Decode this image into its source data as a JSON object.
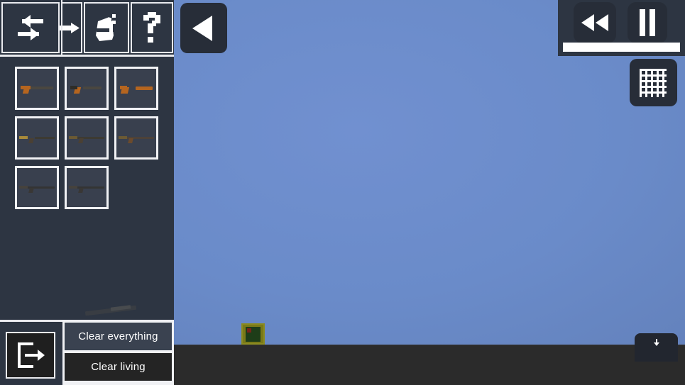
{
  "app": {
    "title": "Weapon Sandbox Editor",
    "background_sky_color": "#6a8bc9",
    "ground_color": "#2b2b2b",
    "panel_color": "#2d3542",
    "outline_color": "#e9eaee"
  },
  "toolbar": {
    "buttons": [
      {
        "name": "swap-tool",
        "icon": "swap-arrows-icon",
        "label": "Swap"
      },
      {
        "name": "move-tool",
        "icon": "arrow-right-icon",
        "label": "Move"
      },
      {
        "name": "paint-tool",
        "icon": "spray-can-icon",
        "label": "Paint"
      },
      {
        "name": "help-tool",
        "icon": "question-mark-icon",
        "label": "Help"
      }
    ]
  },
  "weapon_grid": {
    "rows": [
      [
        {
          "slot": 1,
          "name": "pistol",
          "label": "Pistol"
        },
        {
          "slot": 2,
          "name": "smg",
          "label": "SMG"
        },
        {
          "slot": 3,
          "name": "sawn-off",
          "label": "Sawn-off Shotgun"
        }
      ],
      [
        {
          "slot": 4,
          "name": "carbine",
          "label": "Carbine"
        },
        {
          "slot": 5,
          "name": "assault-rifle",
          "label": "Assault Rifle"
        },
        {
          "slot": 6,
          "name": "battle-rifle",
          "label": "Battle Rifle"
        }
      ],
      [
        {
          "slot": 7,
          "name": "sniper-rifle",
          "label": "Sniper Rifle"
        },
        {
          "slot": 8,
          "name": "machine-gun",
          "label": "Machine Gun"
        }
      ]
    ]
  },
  "preview": {
    "name": "selected-weapon-preview",
    "label": "Selected weapon preview"
  },
  "bottom_panel": {
    "exit_button": {
      "icon": "exit-icon",
      "label": "Exit"
    },
    "clear_everything_label": "Clear everything",
    "clear_living_label": "Clear living"
  },
  "overlay": {
    "back_button": {
      "icon": "play-left-icon",
      "label": "Back"
    },
    "rewind_button": {
      "icon": "rewind-icon",
      "label": "Rewind"
    },
    "pause_button": {
      "icon": "pause-icon",
      "label": "Pause"
    },
    "grid_button": {
      "icon": "grid-icon",
      "label": "Toggle grid"
    },
    "timebar": {
      "name": "time-slider",
      "value": 100
    },
    "bottom_right_button": {
      "icon": "download-icon",
      "label": ""
    }
  },
  "scene": {
    "entity": {
      "name": "zombie-entity",
      "label": "Zombie"
    }
  }
}
